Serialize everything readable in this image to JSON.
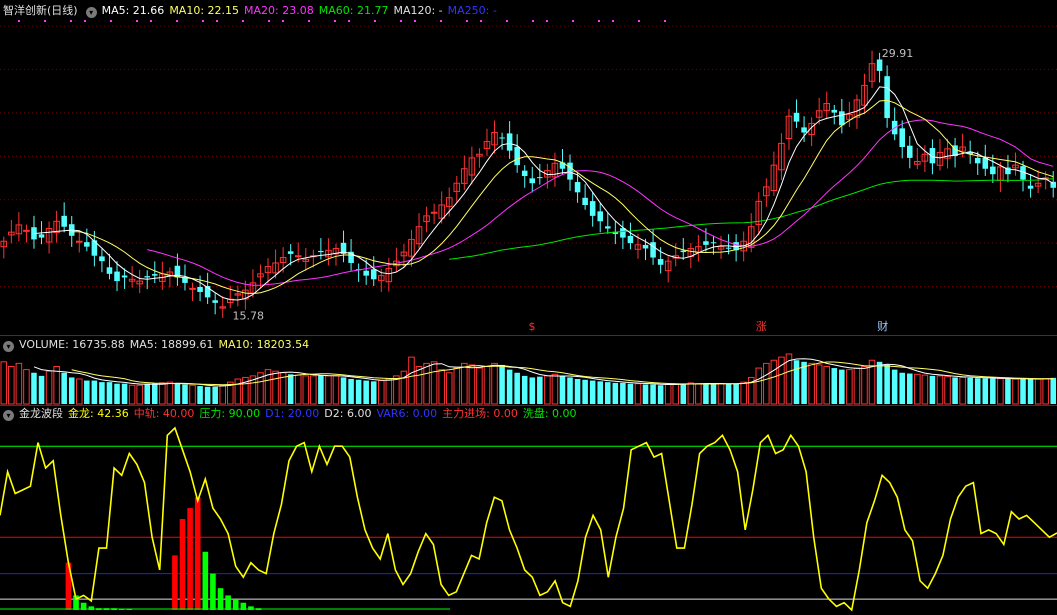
{
  "colors": {
    "up": "#ff3232",
    "down": "#54ffff",
    "ma5": "#ffffff",
    "ma10": "#ffff66",
    "ma20": "#ff33ff",
    "ma60": "#00e600",
    "ma120": "#e0e0e0",
    "ma250": "#3333ff",
    "grid": "#7a0000",
    "label": "#c0c0c0",
    "yellow": "#ffff00",
    "red": "#ff0000",
    "green": "#00ff00",
    "blue": "#1e1eff"
  },
  "main": {
    "title": "智洋创新(日线)",
    "toggle_icon": "chevron-down-icon",
    "ma_labels": [
      {
        "text": "MA5: 21.66",
        "color": "#ffffff"
      },
      {
        "text": "MA10: 22.15",
        "color": "#ffff66"
      },
      {
        "text": "MA20: 23.08",
        "color": "#ff33ff"
      },
      {
        "text": "MA60: 21.77",
        "color": "#00e600"
      },
      {
        "text": "MA120: -",
        "color": "#e0e0e0"
      },
      {
        "text": "MA250: -",
        "color": "#3333ff"
      }
    ],
    "high_label": "29.91",
    "low_label": "15.78",
    "event_markers": [
      "$",
      "涨",
      "财"
    ]
  },
  "volume": {
    "labels": [
      {
        "text": "VOLUME: 16735.88",
        "color": "#e0e0e0"
      },
      {
        "text": "MA5: 18899.61",
        "color": "#e0e0e0"
      },
      {
        "text": "MA10: 18203.54",
        "color": "#ffff66"
      }
    ]
  },
  "indicator": {
    "labels": [
      {
        "text": "金龙波段",
        "color": "#e0e0e0"
      },
      {
        "text": "金龙: 42.36",
        "color": "#ffff00"
      },
      {
        "text": "中轨: 40.00",
        "color": "#ff3232"
      },
      {
        "text": "压力: 90.00",
        "color": "#00e600"
      },
      {
        "text": "D1: 20.00",
        "color": "#3333ff"
      },
      {
        "text": "D2: 6.00",
        "color": "#e0e0e0"
      },
      {
        "text": "VAR6: 0.00",
        "color": "#3333ff"
      },
      {
        "text": "主力进场: 0.00",
        "color": "#ff3232"
      },
      {
        "text": "洗盘: 0.00",
        "color": "#00e600"
      }
    ],
    "levels": {
      "pressure": 90,
      "mid": 40,
      "d1": 20,
      "d2": 6
    }
  },
  "chart_data": [
    {
      "type": "candlestick",
      "title": "智洋创新(日线)",
      "ylim": [
        14.5,
        31.5
      ],
      "x": [
        "1",
        "2",
        "3",
        "4",
        "5",
        "6",
        "7",
        "8",
        "9",
        "10",
        "11",
        "12",
        "13",
        "14",
        "15",
        "16",
        "17",
        "18",
        "19",
        "20",
        "21",
        "22",
        "23",
        "24",
        "25",
        "26",
        "27",
        "28",
        "29",
        "30",
        "31",
        "32",
        "33",
        "34",
        "35",
        "36",
        "37",
        "38",
        "39",
        "40",
        "41",
        "42",
        "43",
        "44",
        "45",
        "46",
        "47",
        "48",
        "49",
        "50",
        "51",
        "52",
        "53",
        "54",
        "55",
        "56",
        "57",
        "58",
        "59",
        "60",
        "61",
        "62",
        "63",
        "64",
        "65",
        "66",
        "67",
        "68",
        "69",
        "70",
        "71",
        "72",
        "73",
        "74",
        "75",
        "76",
        "77",
        "78",
        "79",
        "80",
        "81",
        "82",
        "83",
        "84",
        "85",
        "86",
        "87",
        "88",
        "89",
        "90",
        "91",
        "92",
        "93",
        "94",
        "95",
        "96",
        "97",
        "98",
        "99",
        "100",
        "101",
        "102",
        "103",
        "104",
        "105",
        "106",
        "107",
        "108",
        "109",
        "110",
        "111",
        "112",
        "113",
        "114",
        "115",
        "116",
        "117",
        "118",
        "119",
        "120",
        "121",
        "122",
        "123",
        "124",
        "125",
        "126",
        "127",
        "128",
        "129",
        "130",
        "131",
        "132",
        "133",
        "134",
        "135",
        "136",
        "137",
        "138",
        "139",
        "140",
        "141",
        "142",
        "143",
        "144",
        "145",
        "146",
        "147",
        "148",
        "149",
        "150",
        "151",
        "152",
        "153",
        "154",
        "155",
        "156",
        "157",
        "158",
        "159",
        "160",
        "161",
        "162",
        "163",
        "164",
        "165",
        "166",
        "167",
        "168",
        "169",
        "170",
        "171",
        "172",
        "173",
        "174",
        "175",
        "176",
        "177",
        "178",
        "179",
        "180",
        "181",
        "182",
        "183",
        "184",
        "185",
        "186",
        "187",
        "188",
        "189",
        "190",
        "191",
        "192",
        "193",
        "194",
        "195",
        "196",
        "197",
        "198",
        "199",
        "200",
        "201",
        "202",
        "203",
        "204",
        "205",
        "206",
        "207",
        "208",
        "209",
        "210",
        "211",
        "212",
        "213",
        "214",
        "215",
        "216",
        "217",
        "218",
        "219",
        "220",
        "221",
        "222",
        "223",
        "224",
        "225",
        "226",
        "227",
        "228",
        "229",
        "230",
        "231",
        "232",
        "233",
        "234",
        "235",
        "236",
        "237",
        "238",
        "239",
        "240",
        "241",
        "242",
        "243",
        "244",
        "245",
        "246",
        "247",
        "248",
        "249",
        "250",
        "251",
        "252",
        "253",
        "254",
        "255",
        "256",
        "257",
        "258",
        "259",
        "260",
        "261",
        "262",
        "263",
        "264",
        "265",
        "266",
        "267",
        "268",
        "269",
        "270"
      ],
      "close": [
        19.4,
        19.9,
        20.3,
        20.0,
        19.5,
        19.6,
        20.1,
        20.5,
        20.2,
        19.7,
        19.4,
        19.1,
        18.6,
        18.3,
        17.6,
        17.2,
        17.4,
        17.3,
        17.2,
        17.4,
        17.5,
        17.6,
        17.7,
        17.4,
        17.1,
        16.8,
        16.6,
        16.3,
        16.0,
        15.78,
        16.2,
        16.5,
        16.7,
        17.1,
        17.6,
        18.0,
        18.2,
        18.5,
        18.7,
        18.6,
        18.4,
        18.6,
        18.8,
        18.9,
        19.0,
        18.7,
        18.2,
        17.8,
        17.5,
        17.3,
        17.5,
        17.9,
        18.3,
        18.8,
        19.5,
        20.2,
        20.8,
        21.0,
        21.4,
        21.8,
        22.6,
        23.4,
        24.0,
        24.2,
        24.9,
        25.4,
        25.1,
        24.4,
        23.6,
        23.0,
        22.6,
        22.9,
        23.3,
        23.7,
        23.4,
        22.8,
        22.1,
        21.4,
        20.8,
        20.5,
        20.1,
        19.8,
        19.6,
        19.3,
        19.2,
        19.0,
        18.5,
        18.1,
        18.3,
        18.6,
        18.8,
        19.0,
        19.1,
        19.2,
        19.3,
        19.1,
        19.0,
        18.9,
        19.4,
        20.2,
        21.6,
        22.4,
        23.6,
        24.8,
        26.3,
        26.0,
        25.4,
        25.9,
        26.6,
        27.0,
        26.5,
        25.8,
        26.4,
        27.2,
        28.0,
        29.2,
        28.8,
        26.2,
        25.3,
        24.6,
        24.0,
        23.8,
        24.2,
        23.7,
        24.3,
        24.5,
        24.1,
        24.6,
        24.2,
        23.7,
        23.4,
        23.1,
        23.5,
        23.1,
        23.6,
        22.8,
        22.3,
        22.6,
        22.9,
        22.35
      ],
      "volume": [
        27000,
        24000,
        26000,
        22000,
        20000,
        18000,
        21000,
        24000,
        20000,
        17000,
        16000,
        15000,
        15000,
        14000,
        14000,
        13000,
        13000,
        12000,
        12000,
        13000,
        13000,
        13500,
        14000,
        13000,
        12500,
        12000,
        11500,
        11000,
        11000,
        12000,
        14000,
        16000,
        17000,
        18000,
        20000,
        22000,
        21000,
        20000,
        19000,
        18500,
        18000,
        18000,
        18500,
        18000,
        18000,
        17000,
        16000,
        15500,
        15000,
        14500,
        15000,
        16000,
        18000,
        21000,
        30000,
        24000,
        26000,
        27000,
        22000,
        20000,
        23000,
        26000,
        25000,
        23000,
        24000,
        26000,
        25000,
        22000,
        20000,
        18000,
        17000,
        17500,
        18000,
        19000,
        18000,
        17000,
        16000,
        15500,
        15000,
        14500,
        14000,
        13500,
        13500,
        13000,
        13000,
        12500,
        12500,
        12000,
        12500,
        13000,
        13000,
        13500,
        13000,
        13000,
        13200,
        13000,
        12800,
        13000,
        14000,
        17000,
        23000,
        26000,
        28000,
        30000,
        32000,
        28000,
        27000,
        26000,
        25000,
        24000,
        23000,
        22000,
        22000,
        23000,
        24000,
        28000,
        27000,
        25000,
        22000,
        20000,
        19500,
        19000,
        18500,
        18000,
        18000,
        17500,
        17000,
        17000,
        16800,
        16500,
        16500,
        16300,
        16200,
        16000,
        16000,
        16100,
        16000,
        15900,
        16200,
        16735.88
      ],
      "ma5_series": "MA5",
      "ma10_series": "MA10",
      "ma20_series": "MA20",
      "ma60_series": "MA60"
    },
    {
      "type": "line",
      "title": "金龙波段",
      "ylim": [
        0,
        100
      ],
      "series": [
        {
          "name": "金龙",
          "values": [
            52,
            76,
            64,
            66,
            68,
            92,
            78,
            82,
            52,
            26,
            6,
            8,
            5,
            34,
            34,
            78,
            74,
            86,
            80,
            70,
            40,
            22,
            96,
            100,
            88,
            76,
            60,
            72,
            56,
            50,
            42,
            24,
            18,
            26,
            22,
            20,
            42,
            58,
            82,
            90,
            92,
            76,
            90,
            80,
            90,
            90,
            84,
            62,
            44,
            34,
            28,
            42,
            22,
            14,
            20,
            32,
            42,
            36,
            14,
            8,
            10,
            20,
            30,
            28,
            48,
            62,
            60,
            44,
            34,
            22,
            18,
            8,
            10,
            16,
            4,
            2,
            16,
            40,
            52,
            44,
            18,
            40,
            56,
            88,
            90,
            92,
            84,
            86,
            60,
            34,
            34,
            58,
            86,
            90,
            92,
            96,
            88,
            76,
            44,
            66,
            92,
            96,
            86,
            88,
            96,
            90,
            76,
            40,
            12,
            6,
            2,
            4,
            0,
            22,
            48,
            60,
            74,
            70,
            62,
            44,
            38,
            16,
            12,
            20,
            30,
            50,
            62,
            68,
            70,
            42,
            44,
            42,
            36,
            54,
            50,
            52,
            48,
            44,
            40,
            42.36
          ]
        }
      ],
      "bars": {
        "red_note": "主力进场",
        "green_note": "洗盘"
      }
    }
  ]
}
